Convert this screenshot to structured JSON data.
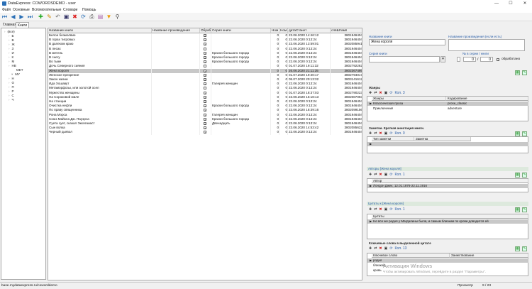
{
  "window": {
    "title": "DataExpress: COWORDSDEMO - user",
    "min": "—",
    "max": "☐",
    "close": "✕"
  },
  "menu": [
    "Файл",
    "Основные",
    "Вспомогательные",
    "Словари",
    "Помощь"
  ],
  "toolbar_icons": [
    "first-icon",
    "prev-icon",
    "next-icon",
    "last-icon",
    "add-icon",
    "edit-icon",
    "undo-icon",
    "save-icon",
    "delete-icon",
    "refresh-icon",
    "print-icon",
    "export-icon",
    "filter-icon",
    "search-icon"
  ],
  "left_tabs": {
    "main": "Главная",
    "books": "Книги"
  },
  "tree": {
    "items": [
      "(все)",
      "Б",
      "В",
      "Ж",
      "З",
      "И",
      "К",
      "М",
      "НВ",
      "МЕТ",
      "МУ",
      "Н",
      "О",
      "П",
      "Р",
      "С",
      "Ч"
    ],
    "selected": "МЕТ"
  },
  "grid": {
    "headers": [
      "Название книги",
      "Название произведения",
      "Обраб",
      "Серия книги",
      "Ном",
      "Ном",
      "датаСтанет",
      "слвШтамп"
    ],
    "rows": [
      {
        "title": "Белое безмолвие",
        "work": "",
        "done": true,
        "series": "",
        "n1": "0",
        "n2": "0",
        "date": "23.06.2020 14:46:12",
        "stamp": "3801946404"
      },
      {
        "title": "В горах тигровых",
        "work": "",
        "done": true,
        "series": "",
        "n1": "0",
        "n2": "0",
        "date": "22.06.2020 0:13:24",
        "stamp": "3801946404"
      },
      {
        "title": "В далеком краю",
        "work": "",
        "done": true,
        "series": "",
        "n1": "0",
        "n2": "0",
        "date": "23.06.2020 13:59:01",
        "stamp": "3802085941"
      },
      {
        "title": "В лесах",
        "work": "",
        "done": false,
        "series": "",
        "n1": "0",
        "n2": "0",
        "date": "22.06.2020 0:13:24",
        "stamp": "3801946404"
      },
      {
        "title": "В метель",
        "work": "",
        "done": true,
        "series": "Краски большого города",
        "n1": "0",
        "n2": "0",
        "date": "22.06.2020 0:13:24",
        "stamp": "3801946404"
      },
      {
        "title": "В снегу",
        "work": "",
        "done": true,
        "series": "Краски большого города",
        "n1": "0",
        "n2": "0",
        "date": "22.06.2020 0:13:24",
        "stamp": "3801946404"
      },
      {
        "title": "Во тьме",
        "work": "",
        "done": true,
        "series": "Краски большого города",
        "n1": "0",
        "n2": "0",
        "date": "22.06.2020 0:13:24",
        "stamp": "3801946404"
      },
      {
        "title": "Дочь Северного сияния",
        "work": "",
        "done": false,
        "series": "",
        "n1": "0",
        "n2": "0",
        "date": "01.07.2020 19:11:32",
        "stamp": "3802792282"
      },
      {
        "title": "Жена короля",
        "work": "",
        "done": true,
        "series": "",
        "n1": "0",
        "n2": "0",
        "date": "26.06.2020 21:11:35",
        "stamp": "3802367495"
      },
      {
        "title": "Женское презрение",
        "work": "",
        "done": true,
        "series": "",
        "n1": "0",
        "n2": "0",
        "date": "01.07.2020 19:40:17",
        "stamp": "3802794017"
      },
      {
        "title": "Закон жизни",
        "work": "",
        "done": true,
        "series": "",
        "n1": "0",
        "n2": "0",
        "date": "05.07.2020 20:13:32",
        "stamp": "3803141612"
      },
      {
        "title": "Ида Хошавут",
        "work": "",
        "done": true,
        "series": "Галерея женщин",
        "n1": "0",
        "n2": "0",
        "date": "22.06.2020 0:13:24",
        "stamp": "3801946404"
      },
      {
        "title": "Метаморфозы, или золотой осел",
        "work": "",
        "done": false,
        "series": "",
        "n1": "0",
        "n2": "0",
        "date": "22.06.2020 0:13:24",
        "stamp": "3801946404"
      },
      {
        "title": "Мужество женщины",
        "work": "",
        "done": true,
        "series": "",
        "n1": "0",
        "n2": "0",
        "date": "01.07.2020 18:37:03",
        "stamp": "3802790223"
      },
      {
        "title": "На Сороковой миле",
        "work": "",
        "done": true,
        "series": "",
        "n1": "0",
        "n2": "0",
        "date": "23.06.2020 15:18:13",
        "stamp": "3802087093"
      },
      {
        "title": "На станции",
        "work": "",
        "done": true,
        "series": "",
        "n1": "0",
        "n2": "0",
        "date": "22.06.2020 0:13:24",
        "stamp": "3801946404"
      },
      {
        "title": "Очистка нефти",
        "work": "",
        "done": true,
        "series": "Краски большого города",
        "n1": "0",
        "n2": "0",
        "date": "22.06.2020 0:13:24",
        "stamp": "3801946404"
      },
      {
        "title": "По праву священника",
        "work": "",
        "done": true,
        "series": "",
        "n1": "0",
        "n2": "0",
        "date": "23.06.2020 18:39:16",
        "stamp": "3802099156"
      },
      {
        "title": "Рона Мэрса",
        "work": "",
        "done": true,
        "series": "Галерея женщин",
        "n1": "0",
        "n2": "0",
        "date": "22.06.2020 0:13:24",
        "stamp": "3801946404"
      },
      {
        "title": "Союз Майкла Дж. Пауэрса",
        "work": "",
        "done": true,
        "series": "Краски большого города",
        "n1": "0",
        "n2": "0",
        "date": "22.06.2020 0:13:24",
        "stamp": "3801946404"
      },
      {
        "title": "Суета сует, сказал Экклезиаст",
        "work": "",
        "done": true,
        "series": "Двенадцать",
        "n1": "0",
        "n2": "0",
        "date": "22.06.2020 0:13:24",
        "stamp": "3801946404"
      },
      {
        "title": "Сын волка",
        "work": "",
        "done": true,
        "series": "",
        "n1": "0",
        "n2": "0",
        "date": "23.06.2020 14:53:42",
        "stamp": "3802085622"
      },
      {
        "title": "Черный дьявол",
        "work": "",
        "done": true,
        "series": "",
        "n1": "0",
        "n2": "0",
        "date": "22.06.2020 0:13:24",
        "stamp": "3801946404"
      }
    ],
    "selected_index": 8
  },
  "detail": {
    "book_title_label": "Название книги",
    "book_title_value": "Жена короля",
    "work_title_label": "Название произведения (если есть)",
    "work_title_value": "",
    "series_label": "Серия книги",
    "series_value": "",
    "series_num_label": "№ в серии / книги",
    "num1": "0",
    "num2": "0",
    "processed_label": "обработано",
    "genres": {
      "title": "Жанры",
      "count_link": "Кол. 3",
      "headers": [
        "Жанры",
        "Кодирование"
      ],
      "rows": [
        {
          "name": "Классическая проза",
          "code": "prose_classic"
        },
        {
          "name": "Приключения",
          "code": "adventure"
        }
      ]
    },
    "notes": {
      "title": "Заметки. Краткая аннотация книги.",
      "count_link": "Кол. 0",
      "headers": [
        "Тип заметки",
        "Заметка"
      ]
    },
    "authors": {
      "title": "Авторы [Жена короля]",
      "count_link": "Кол. 1",
      "header": "Автор",
      "value": "Лондон Джек, 12.01.1876-22.11.1916"
    },
    "quotes": {
      "title": "Цитаты к [Жена короля]",
      "count_link": "Кол. 1",
      "header": "Цитаты",
      "value": "Не все же родня у Магдалины была, и самым близким по крови доводится ей"
    },
    "keywords": {
      "title": "Ключевые слова в выделенной цитате",
      "count_link": "Кол. 13",
      "headers": [
        "Ключевое слово",
        "Заимствование"
      ],
      "rows": [
        "родня",
        "близкой",
        "кровь"
      ]
    }
  },
  "watermark": {
    "line1": "Активация Windows",
    "line2": "Чтобы активировать Windows, перейдите в раздел \"Параметры\"."
  },
  "status": {
    "url": "base.mydataexpress.ru/coworddemo",
    "mode": "Просмотр",
    "position": "9 / 23"
  }
}
